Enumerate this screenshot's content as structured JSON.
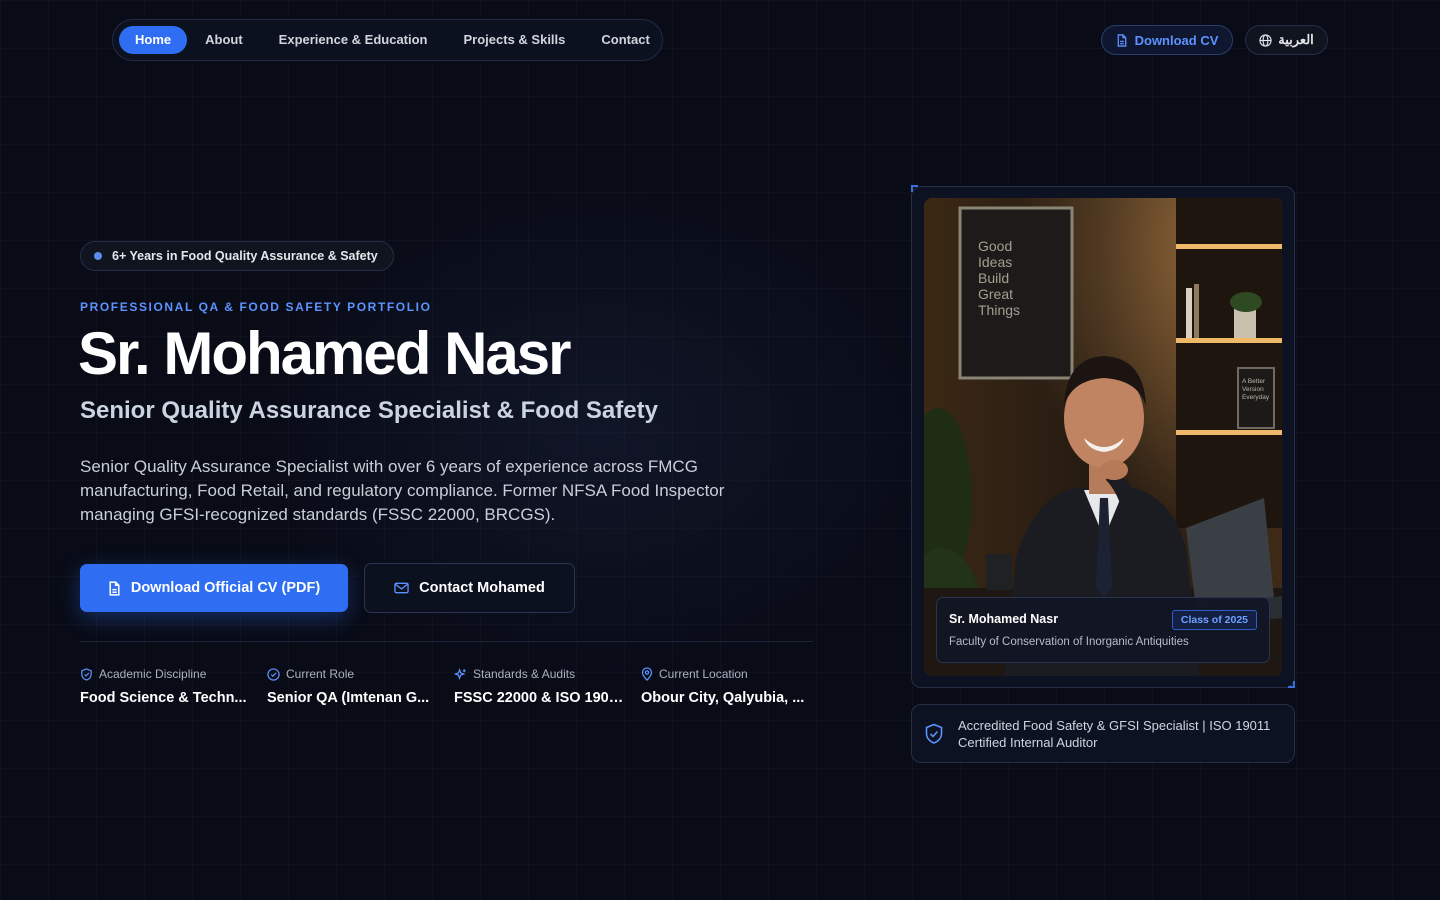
{
  "nav": {
    "items": [
      {
        "label": "Home",
        "active": true
      },
      {
        "label": "About",
        "active": false
      },
      {
        "label": "Experience & Education",
        "active": false
      },
      {
        "label": "Projects & Skills",
        "active": false
      },
      {
        "label": "Contact",
        "active": false
      }
    ],
    "download_cv": "Download CV",
    "language": "العربية"
  },
  "hero": {
    "badge": "6+ Years in Food Quality Assurance & Safety",
    "eyebrow": "PROFESSIONAL QA & FOOD SAFETY PORTFOLIO",
    "name": "Sr. Mohamed Nasr",
    "title": "Senior Quality Assurance Specialist & Food Safety",
    "description": "Senior Quality Assurance Specialist with over 6 years of experience across FMCG manufacturing, Food Retail, and regulatory compliance. Former NFSA Food Inspector managing GFSI-recognized standards (FSSC 22000, BRCGS).",
    "primary_button": "Download Official CV (PDF)",
    "secondary_button": "Contact Mohamed"
  },
  "stats": [
    {
      "label": "Academic Discipline",
      "value": "Food Science & Techn...",
      "icon": "shield-icon"
    },
    {
      "label": "Current Role",
      "value": "Senior QA (Imtenan G...",
      "icon": "check-circle-icon"
    },
    {
      "label": "Standards & Audits",
      "value": "FSSC 22000 & ISO 19011...",
      "icon": "sparkle-icon"
    },
    {
      "label": "Current Location",
      "value": "Obour City, Qalyubia, ...",
      "icon": "map-pin-icon"
    }
  ],
  "profile_card": {
    "poster_text": "Good Ideas Build Great Things",
    "shelf_text": "A Better Version Everyday",
    "name": "Sr. Mohamed Nasr",
    "class_badge": "Class of 2025",
    "faculty": "Faculty of Conservation of Inorganic Antiquities"
  },
  "certification": "Accredited Food Safety & GFSI Specialist | ISO 19011 Certified Internal Auditor",
  "colors": {
    "background": "#090c17",
    "accent": "#2f6ef2",
    "accent_text": "#5c93ff"
  }
}
